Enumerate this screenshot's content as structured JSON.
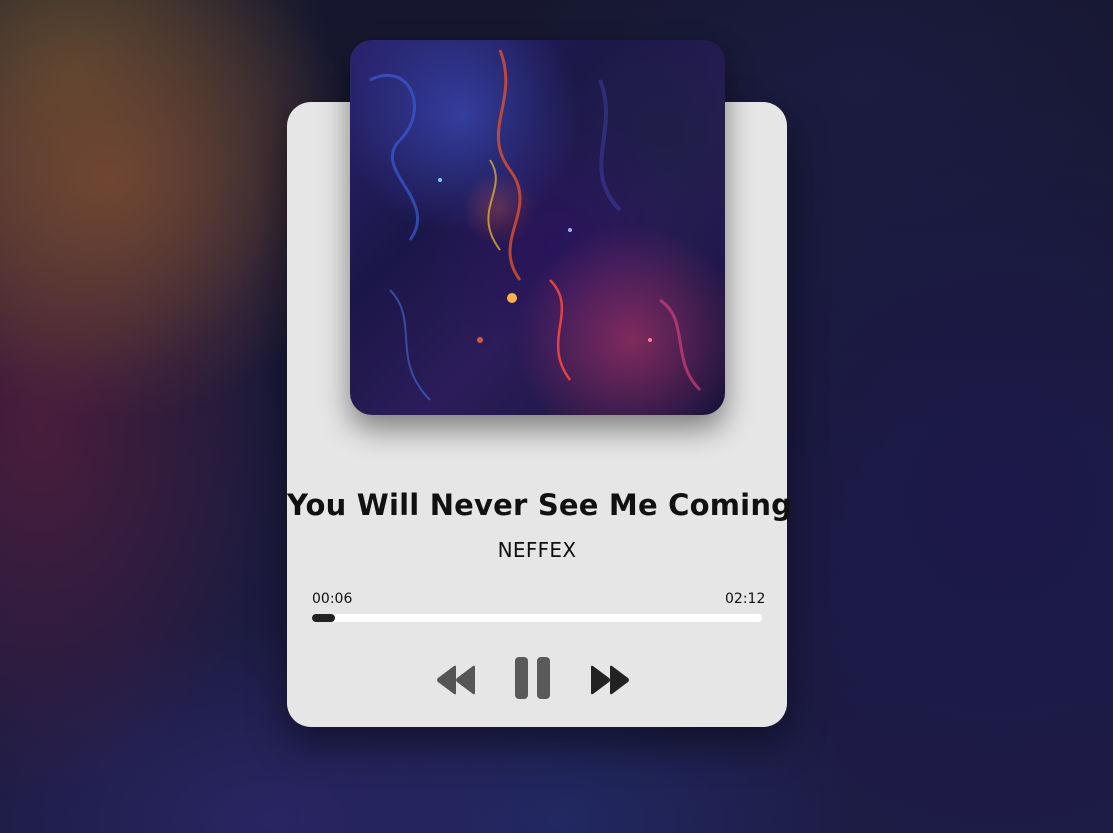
{
  "player": {
    "title": "You Will Never See Me Coming",
    "artist": "NEFFEX",
    "current_time": "00:06",
    "duration": "02:12",
    "progress_fraction": 0.05,
    "is_playing": true
  },
  "controls": {
    "previous_icon": "rewind-icon",
    "pause_icon": "pause-icon",
    "next_icon": "fast-forward-icon"
  },
  "colors": {
    "card_background": "#e6e6e6",
    "progress_track": "#ffffff",
    "progress_fill": "#222222",
    "control_previous": "#555555",
    "control_pause": "#5a5a5a",
    "control_next": "#222222"
  }
}
